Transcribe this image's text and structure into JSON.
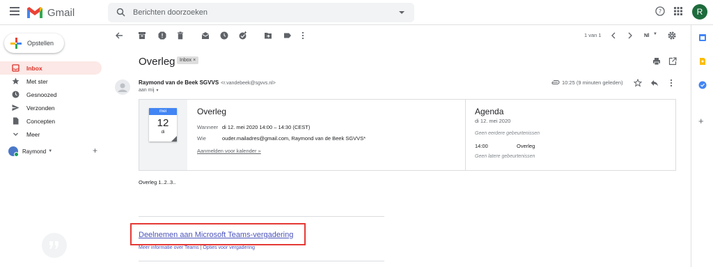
{
  "topbar": {
    "app_name": "Gmail",
    "search_placeholder": "Berichten doorzoeken",
    "avatar_initial": "R"
  },
  "sidebar": {
    "compose_label": "Opstellen",
    "items": [
      {
        "label": "Inbox",
        "icon": "inbox-icon",
        "active": true
      },
      {
        "label": "Met ster",
        "icon": "star-icon",
        "active": false
      },
      {
        "label": "Gesnoozed",
        "icon": "clock-icon",
        "active": false
      },
      {
        "label": "Verzonden",
        "icon": "send-icon",
        "active": false
      },
      {
        "label": "Concepten",
        "icon": "file-icon",
        "active": false
      },
      {
        "label": "Meer",
        "icon": "chevron-down-icon",
        "active": false
      }
    ],
    "hangouts_user": "Raymond"
  },
  "toolbar": {
    "pager": "1 van 1",
    "input_tool": "Nl"
  },
  "message": {
    "subject": "Overleg",
    "label": "Inbox",
    "sender_name": "Raymond van de Beek SGVVS",
    "sender_email": "<r.vandebeek@sgvvs.nl>",
    "to": "aan mij",
    "time": "10:25 (9 minuten geleden)",
    "body": "Overleg 1..2..3.."
  },
  "invite": {
    "cal_month": "mei",
    "cal_day": "12",
    "cal_dow": "di",
    "title": "Overleg",
    "when_label": "Wanneer",
    "when_value": "di 12. mei 2020 14:00 – 14:30 (CEST)",
    "who_label": "Wie",
    "who_value": "ouder.mailadres@gmail.com, Raymond van de Beek SGVVS*",
    "rsvp_link": "Aanmelden voor kalender »"
  },
  "agenda": {
    "title": "Agenda",
    "date": "di 12. mei 2020",
    "no_earlier": "Geen eerdere gebeurtenissen",
    "event_time": "14:00",
    "event_title": "Overleg",
    "no_later": "Geen latere gebeurtenissen"
  },
  "teams": {
    "join_link": "Deelnemen aan Microsoft Teams-vergadering",
    "more_info": "Meer informatie over Teams",
    "separator": "|",
    "options": "Opties voor vergadering"
  },
  "colors": {
    "accent_red": "#d93025",
    "active_bg": "#fce8e6",
    "teams_link": "#4b53bc",
    "highlight_box": "#e53935",
    "calendar_blue": "#4285f4"
  }
}
